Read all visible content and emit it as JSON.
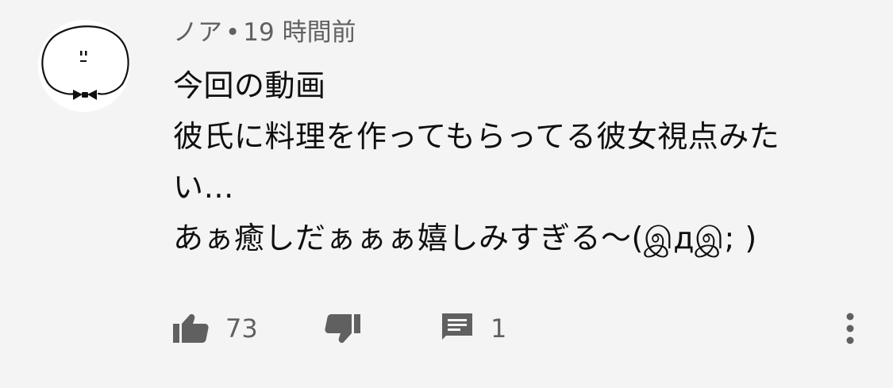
{
  "comment": {
    "author": "ノア",
    "separator": "•",
    "time": "19 時間前",
    "lines": [
      "今回の動画",
      "彼氏に料理を作ってもらってる彼女視点みた",
      "い…",
      "あぁ癒しだぁぁぁ嬉しみすぎる〜(இдஇ; )"
    ],
    "avatar_icon": "bowtie-face-avatar-icon"
  },
  "actions": {
    "like_count": "73",
    "reply_count": "1",
    "like_icon": "thumbs-up-icon",
    "dislike_icon": "thumbs-down-icon",
    "reply_icon": "comment-icon",
    "more_icon": "vertical-dots-icon"
  },
  "colors": {
    "background": "#f4f4f4",
    "primary_text": "#0f0f0f",
    "secondary_text": "#606060",
    "icon": "#606060"
  }
}
